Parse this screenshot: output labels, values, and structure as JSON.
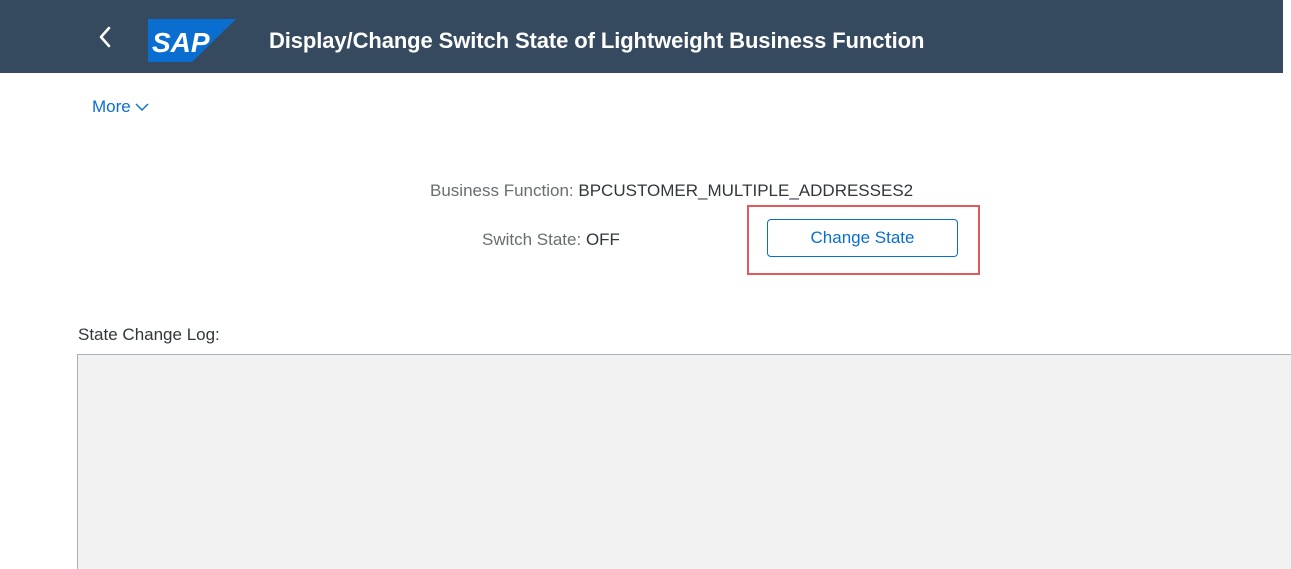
{
  "header": {
    "title": "Display/Change Switch State of Lightweight Business Function",
    "logo_text": "SAP",
    "back_icon": "chevron-left-icon",
    "background_color": "#354a5f",
    "logo_color": "#0a6ed1"
  },
  "toolbar": {
    "more_label": "More"
  },
  "form": {
    "business_function_label": "Business Function:",
    "business_function_value": "BPCUSTOMER_MULTIPLE_ADDRESSES2",
    "switch_state_label": "Switch State:",
    "switch_state_value": "OFF",
    "change_state_button": "Change State"
  },
  "log": {
    "label": "State Change Log:",
    "content": ""
  },
  "colors": {
    "link": "#0a6ed1",
    "highlight": "#e05a5e"
  }
}
